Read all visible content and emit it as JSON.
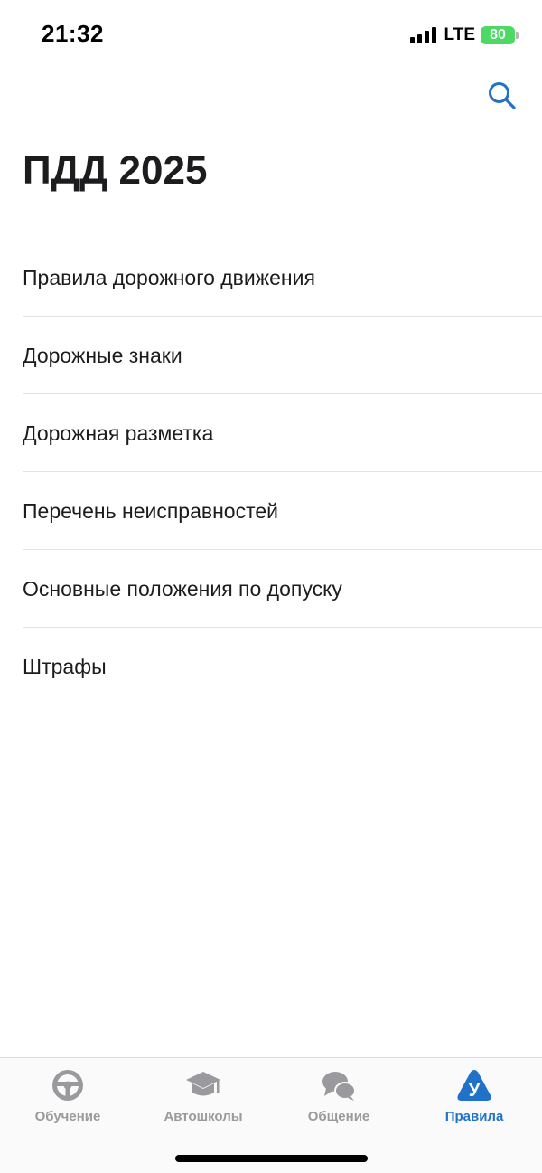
{
  "status_bar": {
    "time": "21:32",
    "network": "LTE",
    "battery": "80"
  },
  "header": {
    "search_icon": "search-icon",
    "title": "ПДД 2025"
  },
  "menu": [
    {
      "label": "Правила дорожного движения"
    },
    {
      "label": "Дорожные знаки"
    },
    {
      "label": "Дорожная разметка"
    },
    {
      "label": "Перечень неисправностей"
    },
    {
      "label": "Основные положения по допуску"
    },
    {
      "label": "Штрафы"
    }
  ],
  "tabs": [
    {
      "label": "Обучение",
      "icon": "steering-wheel-icon",
      "active": false
    },
    {
      "label": "Автошколы",
      "icon": "graduation-cap-icon",
      "active": false
    },
    {
      "label": "Общение",
      "icon": "chat-bubbles-icon",
      "active": false
    },
    {
      "label": "Правила",
      "icon": "road-sign-icon",
      "active": true
    }
  ],
  "colors": {
    "accent": "#1f72c7",
    "inactive": "#9a9a9e",
    "battery": "#4cd964"
  }
}
